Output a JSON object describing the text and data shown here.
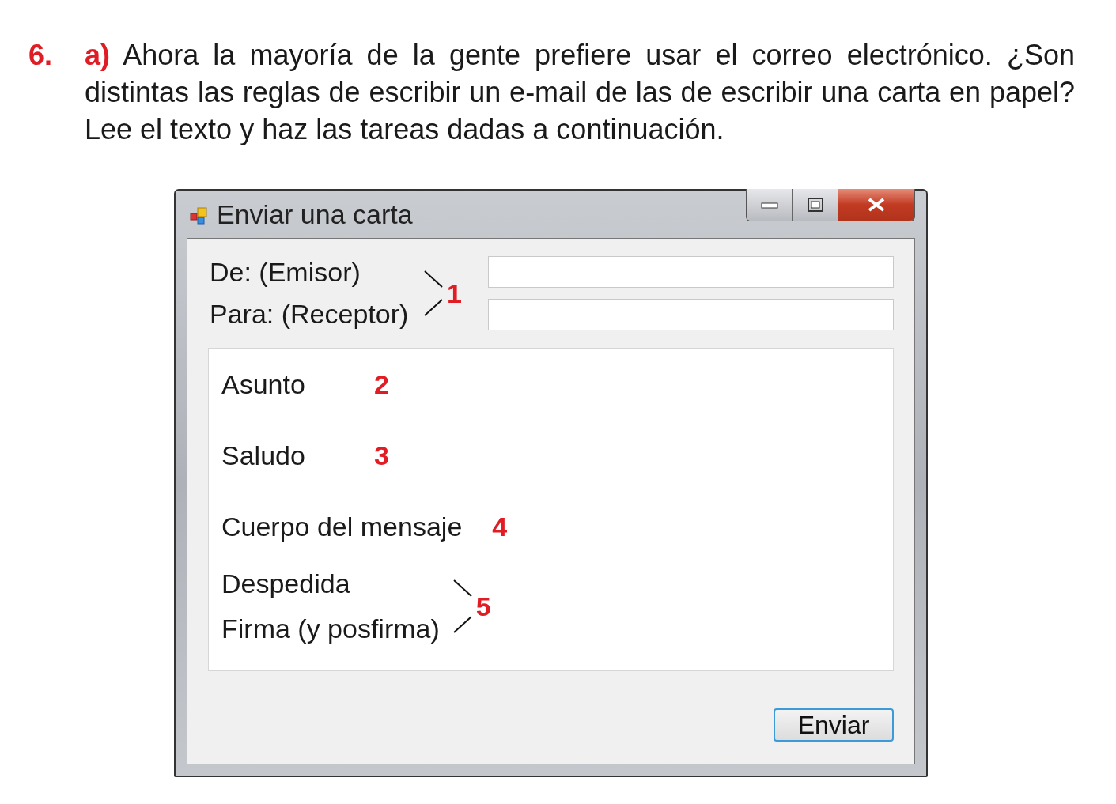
{
  "exercise": {
    "number": "6.",
    "part": "a)",
    "text": "Ahora la mayoría de la gente prefiere usar el correo electrónico. ¿Son distintas las reglas de escribir un e-mail de las de escribir una carta en papel?  Lee el texto y haz las tareas dadas  a continuación."
  },
  "window": {
    "title": "Enviar una carta",
    "fields": [
      {
        "label": "De: (Emisor)"
      },
      {
        "label": "Para: (Receptor)"
      }
    ],
    "fields_marker": "1",
    "body_items": [
      {
        "label": "Asunto",
        "marker": "2"
      },
      {
        "label": "Saludo",
        "marker": "3"
      },
      {
        "label": "Cuerpo del mensaje",
        "marker": "4"
      }
    ],
    "closing_items": [
      {
        "label": "Despedida"
      },
      {
        "label": "Firma (y posfirma)"
      }
    ],
    "closing_marker": "5",
    "send_button": "Enviar"
  }
}
